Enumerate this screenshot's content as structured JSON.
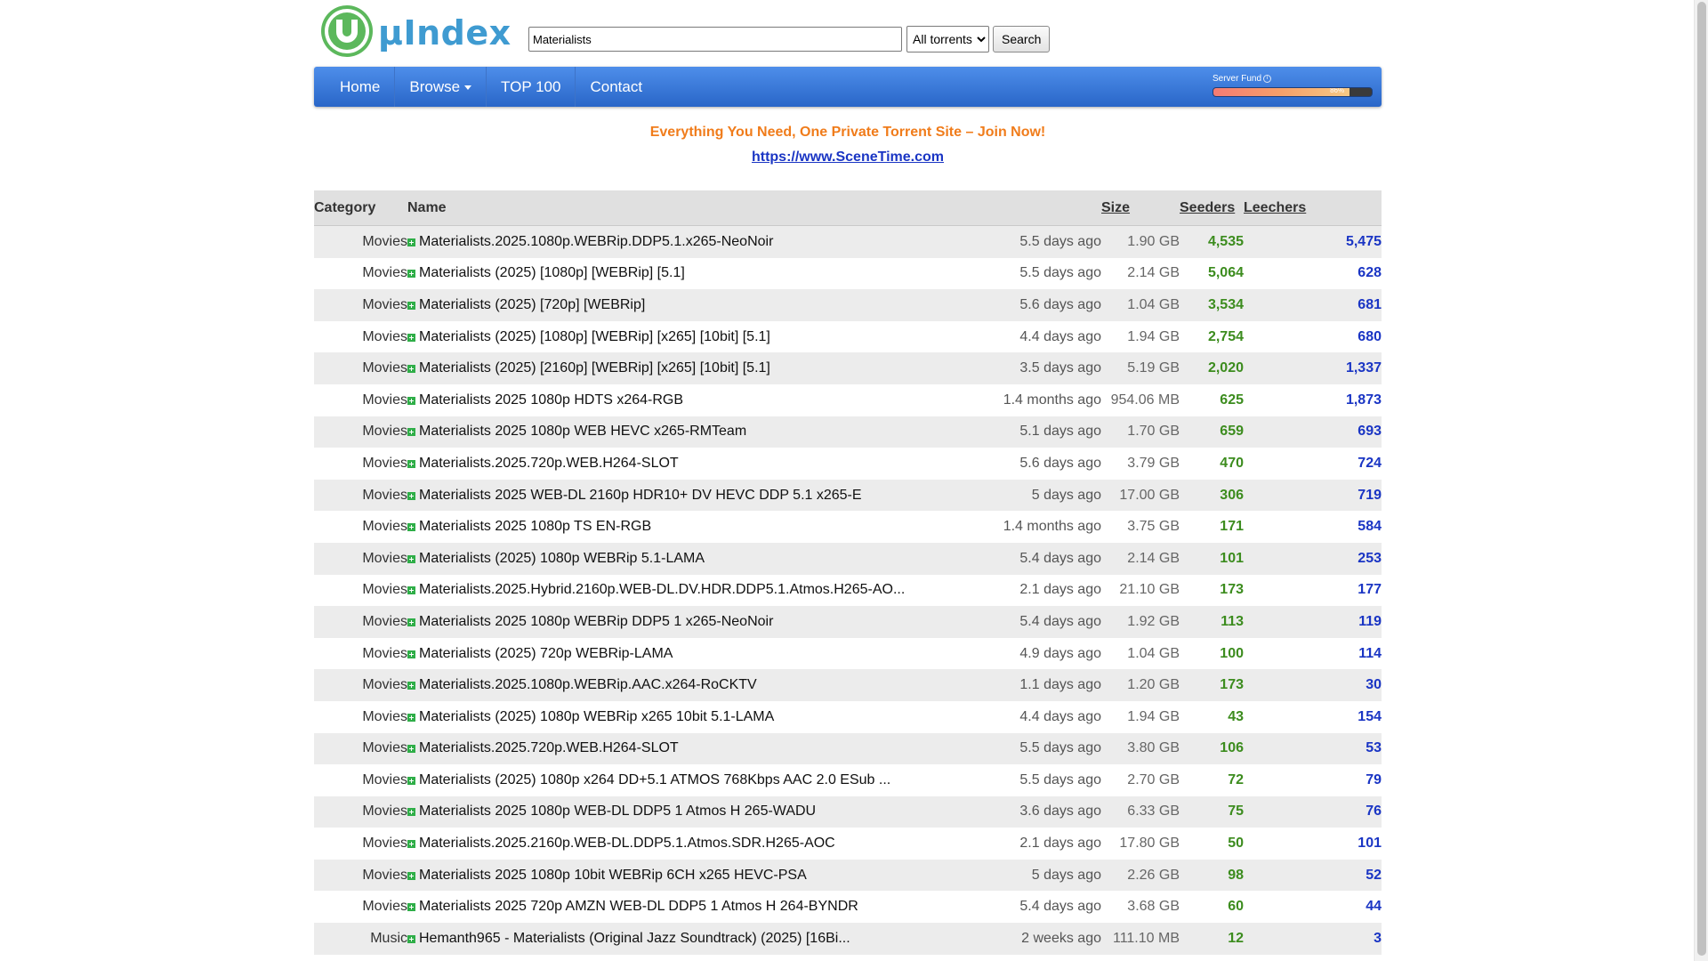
{
  "site": {
    "logo_text": "µIndex"
  },
  "search": {
    "value": "Materialists",
    "select_value": "All torrents",
    "button_label": "Search"
  },
  "nav": {
    "items": [
      "Home",
      "Browse",
      "TOP 100",
      "Contact"
    ]
  },
  "server_fund": {
    "label": "Server Fund",
    "info_icon": "info-icon",
    "percent": 86,
    "percent_text": "86%"
  },
  "promo": {
    "title": "Everything You Need, One Private Torrent Site – Join Now!",
    "link": "https://www.SceneTime.com"
  },
  "table": {
    "headers": {
      "category": "Category",
      "name": "Name",
      "size": "Size",
      "seeders": "Seeders",
      "leechers": "Leechers"
    },
    "rows": [
      {
        "category": "Movies",
        "name": "Materialists.2025.1080p.WEBRip.DDP5.1.x265-NeoNoir",
        "age": "5.5 days ago",
        "size": "1.90 GB",
        "seeders": "4,535",
        "leechers": "5,475"
      },
      {
        "category": "Movies",
        "name": "Materialists (2025) [1080p] [WEBRip] [5.1]",
        "age": "5.5 days ago",
        "size": "2.14 GB",
        "seeders": "5,064",
        "leechers": "628"
      },
      {
        "category": "Movies",
        "name": "Materialists (2025) [720p] [WEBRip]",
        "age": "5.6 days ago",
        "size": "1.04 GB",
        "seeders": "3,534",
        "leechers": "681"
      },
      {
        "category": "Movies",
        "name": "Materialists (2025) [1080p] [WEBRip] [x265] [10bit] [5.1]",
        "age": "4.4 days ago",
        "size": "1.94 GB",
        "seeders": "2,754",
        "leechers": "680"
      },
      {
        "category": "Movies",
        "name": "Materialists (2025) [2160p] [WEBRip] [x265] [10bit] [5.1]",
        "age": "3.5 days ago",
        "size": "5.19 GB",
        "seeders": "2,020",
        "leechers": "1,337"
      },
      {
        "category": "Movies",
        "name": "Materialists 2025 1080p HDTS x264-RGB",
        "age": "1.4 months ago",
        "size": "954.06 MB",
        "seeders": "625",
        "leechers": "1,873"
      },
      {
        "category": "Movies",
        "name": "Materialists 2025 1080p WEB HEVC x265-RMTeam",
        "age": "5.1 days ago",
        "size": "1.70 GB",
        "seeders": "659",
        "leechers": "693"
      },
      {
        "category": "Movies",
        "name": "Materialists.2025.720p.WEB.H264-SLOT",
        "age": "5.6 days ago",
        "size": "3.79 GB",
        "seeders": "470",
        "leechers": "724"
      },
      {
        "category": "Movies",
        "name": "Materialists 2025 WEB-DL 2160p HDR10+ DV HEVC DDP 5.1 x265-E",
        "age": "5 days ago",
        "size": "17.00 GB",
        "seeders": "306",
        "leechers": "719"
      },
      {
        "category": "Movies",
        "name": "Materialists 2025 1080p TS EN-RGB",
        "age": "1.4 months ago",
        "size": "3.75 GB",
        "seeders": "171",
        "leechers": "584"
      },
      {
        "category": "Movies",
        "name": "Materialists (2025) 1080p WEBRip 5.1-LAMA",
        "age": "5.4 days ago",
        "size": "2.14 GB",
        "seeders": "101",
        "leechers": "253"
      },
      {
        "category": "Movies",
        "name": "Materialists.2025.Hybrid.2160p.WEB-DL.DV.HDR.DDP5.1.Atmos.H265-AO...",
        "age": "2.1 days ago",
        "size": "21.10 GB",
        "seeders": "173",
        "leechers": "177"
      },
      {
        "category": "Movies",
        "name": "Materialists 2025 1080p WEBRip DDP5 1 x265-NeoNoir",
        "age": "5.4 days ago",
        "size": "1.92 GB",
        "seeders": "113",
        "leechers": "119"
      },
      {
        "category": "Movies",
        "name": "Materialists (2025) 720p WEBRip-LAMA",
        "age": "4.9 days ago",
        "size": "1.04 GB",
        "seeders": "100",
        "leechers": "114"
      },
      {
        "category": "Movies",
        "name": "Materialists.2025.1080p.WEBRip.AAC.x264-RoCKTV",
        "age": "1.1 days ago",
        "size": "1.20 GB",
        "seeders": "173",
        "leechers": "30"
      },
      {
        "category": "Movies",
        "name": "Materialists (2025) 1080p WEBRip x265 10bit 5.1-LAMA",
        "age": "4.4 days ago",
        "size": "1.94 GB",
        "seeders": "43",
        "leechers": "154"
      },
      {
        "category": "Movies",
        "name": "Materialists.2025.720p.WEB.H264-SLOT",
        "age": "5.5 days ago",
        "size": "3.80 GB",
        "seeders": "106",
        "leechers": "53"
      },
      {
        "category": "Movies",
        "name": "Materialists (2025) 1080p x264 DD+5.1 ATMOS 768Kbps AAC 2.0 ESub ...",
        "age": "5.5 days ago",
        "size": "2.70 GB",
        "seeders": "72",
        "leechers": "79"
      },
      {
        "category": "Movies",
        "name": "Materialists 2025 1080p WEB-DL DDP5 1 Atmos H 265-WADU",
        "age": "3.6 days ago",
        "size": "6.33 GB",
        "seeders": "75",
        "leechers": "76"
      },
      {
        "category": "Movies",
        "name": "Materialists.2025.2160p.WEB-DL.DDP5.1.Atmos.SDR.H265-AOC",
        "age": "2.1 days ago",
        "size": "17.80 GB",
        "seeders": "50",
        "leechers": "101"
      },
      {
        "category": "Movies",
        "name": "Materialists 2025 1080p 10bit WEBRip 6CH x265 HEVC-PSA",
        "age": "5 days ago",
        "size": "2.26 GB",
        "seeders": "98",
        "leechers": "52"
      },
      {
        "category": "Movies",
        "name": "Materialists 2025 720p AMZN WEB-DL DDP5 1 Atmos H 264-BYNDR",
        "age": "5.4 days ago",
        "size": "3.68 GB",
        "seeders": "60",
        "leechers": "44"
      },
      {
        "category": "Music",
        "name": "Hemanth965 - Materialists (Original Jazz Soundtrack) (2025) [16Bi...",
        "age": "2 weeks ago",
        "size": "111.10 MB",
        "seeders": "12",
        "leechers": "3"
      }
    ]
  },
  "colors": {
    "nav_bg": "#2f6fd6",
    "seeders": "#3c8c1e",
    "leechers": "#1a35c4",
    "promo": "#f07c1b",
    "add_icon": "#2fae48"
  }
}
